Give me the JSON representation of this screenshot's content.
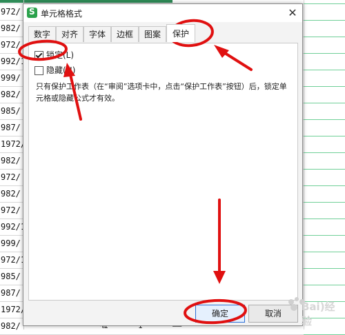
{
  "spreadsheet": {
    "column_a_cells": [
      "972/",
      "982/",
      "972/",
      "992/1",
      "999/",
      "982/",
      "985/",
      "987/",
      "1972/",
      "982/",
      "972/",
      "982/",
      "972/",
      "992/1",
      "999/",
      "972/1",
      "985/",
      "987/",
      "1972/",
      "982/"
    ],
    "bottom_row_texts": [
      "1",
      "1",
      "%",
      "——"
    ]
  },
  "dialog": {
    "title": "单元格格式",
    "close_glyph": "✕",
    "tabs": [
      "数字",
      "对齐",
      "字体",
      "边框",
      "图案",
      "保护"
    ],
    "active_tab": "保护",
    "checkboxes": [
      {
        "label": "锁定(L)",
        "checked": true
      },
      {
        "label": "隐藏(H)",
        "checked": false
      }
    ],
    "description": "只有保护工作表（在“审阅”选项卡中，点击“保护工作表”按钮）后，锁定单元格或隐藏公式才有效。",
    "ok_label": "确定",
    "cancel_label": "取消"
  },
  "watermark": {
    "text": "Bai)经验"
  },
  "colors": {
    "annotation_red": "#e01010",
    "accent_green": "#2ba24c",
    "primary_border": "#2b6fd6"
  }
}
